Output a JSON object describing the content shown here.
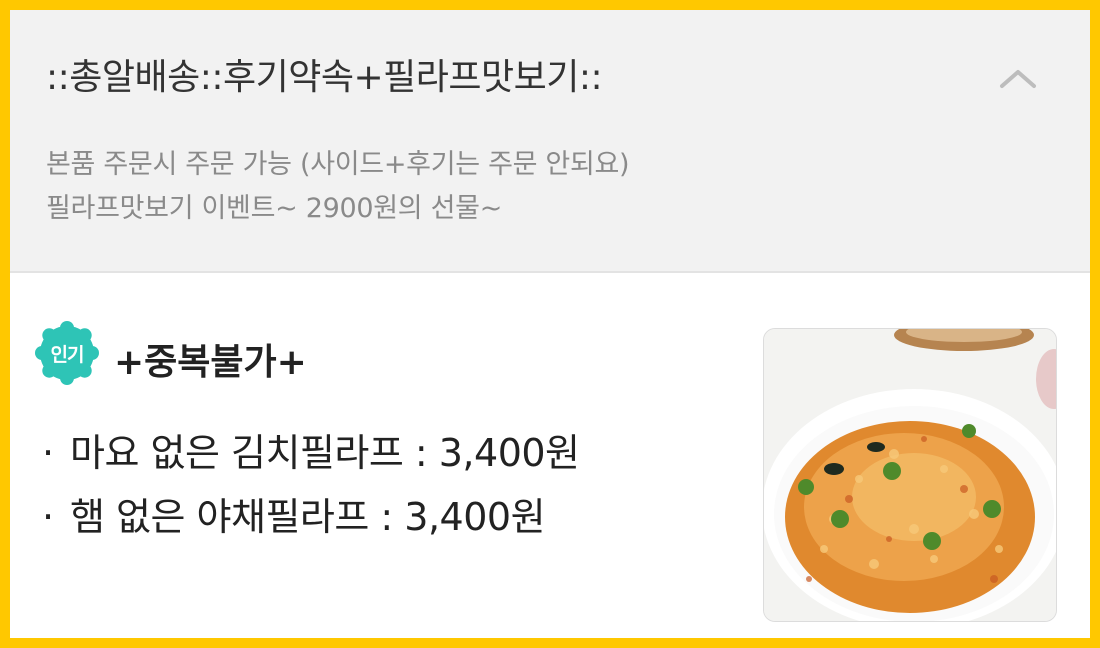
{
  "notice": {
    "title": "::총알배송::후기약속+필라프맛보기::",
    "description_lines": [
      "본품 주문시 주문 가능 (사이드+후기는 주문 안되요)",
      "필라프맛보기 이벤트~ 2900원의 선물~"
    ],
    "collapse_icon": "chevron-up-icon"
  },
  "menu_item": {
    "badge": "인기",
    "name": "+중복불가+",
    "bullet": "·",
    "lines": [
      "마요 없은 김치필라프 : 3,400원",
      "햄 없은 야채필라프 : 3,400원"
    ],
    "image_icon": "kimchi-fried-rice-photo"
  },
  "colors": {
    "frame": "#ffc800",
    "notice_bg": "#f2f2f2",
    "badge": "#2ec4b6"
  }
}
